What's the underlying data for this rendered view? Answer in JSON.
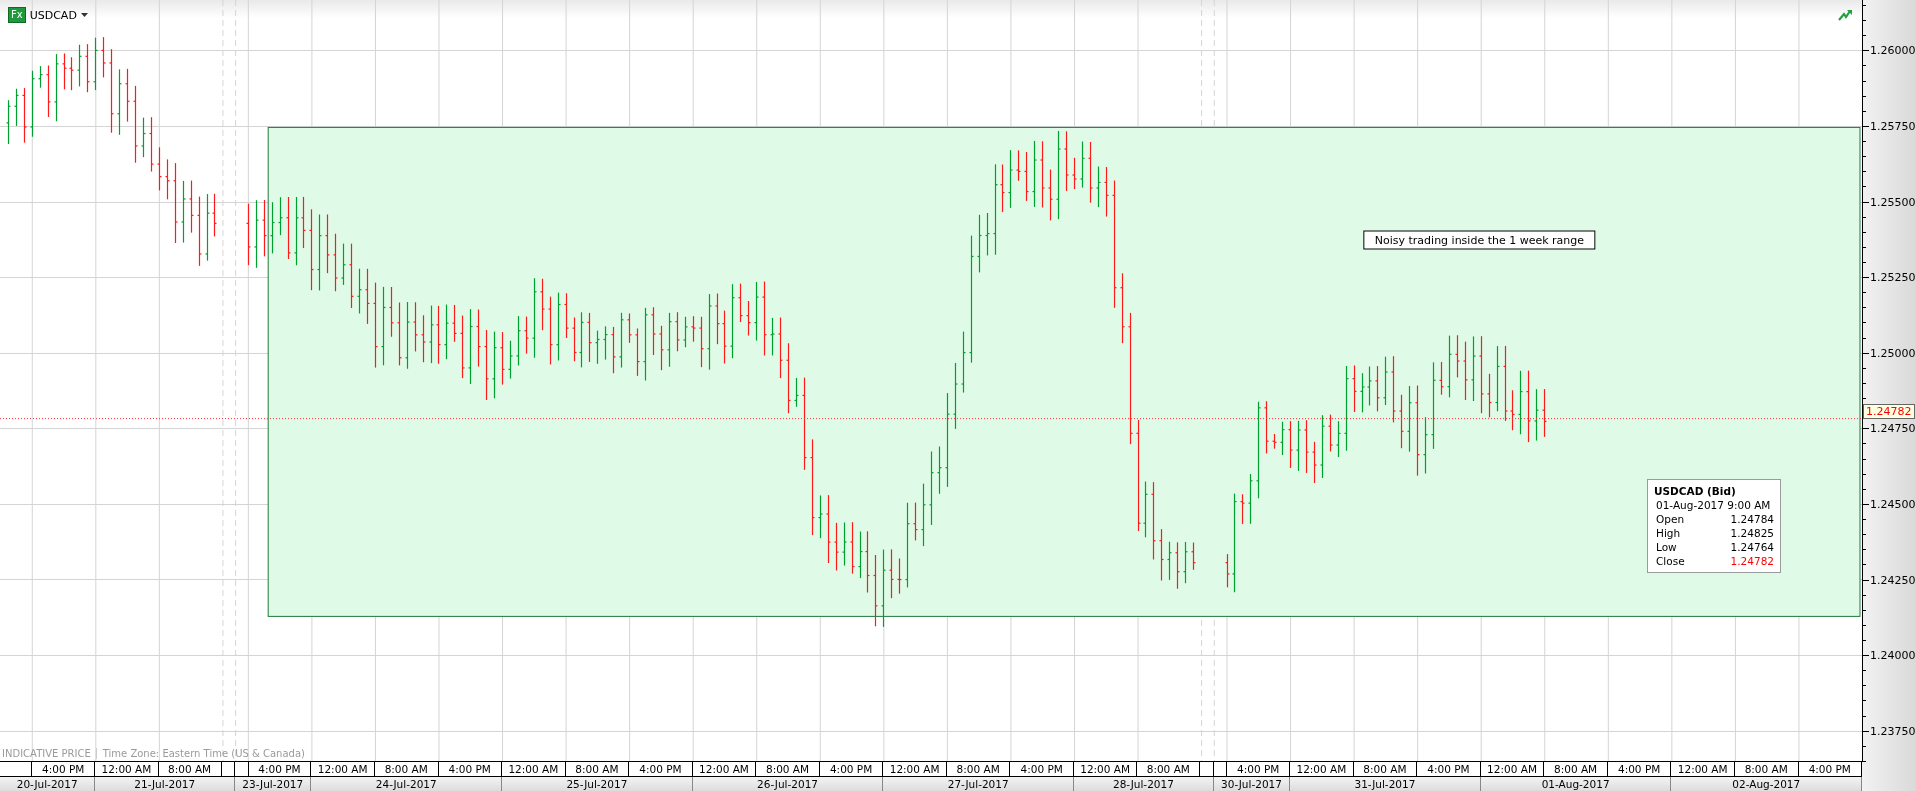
{
  "header": {
    "icon_text": "Fx",
    "symbol": "USDCAD"
  },
  "chart": {
    "price_axis": [
      "1.26000",
      "1.25750",
      "1.25500",
      "1.25250",
      "1.25000",
      "1.24750",
      "1.24500",
      "1.24250",
      "1.24000",
      "1.23750"
    ],
    "current_price": "1.24782",
    "note": "Noisy trading inside the 1 week range",
    "footnote": {
      "source": "INDICATIVE PRICE",
      "timezone": "Time Zone: Eastern Time (US & Canada)"
    },
    "tooltip": {
      "title": "USDCAD (Bid)",
      "time": "01-Aug-2017 9:00 AM",
      "rows": [
        {
          "label": "Open",
          "value": "1.24784",
          "highlight": false
        },
        {
          "label": "High",
          "value": "1.24825",
          "highlight": false
        },
        {
          "label": "Low",
          "value": "1.24764",
          "highlight": false
        },
        {
          "label": "Close",
          "value": "1.24782",
          "highlight": true
        }
      ]
    }
  },
  "time_axis": {
    "days": [
      {
        "date": "20-Jul-2017",
        "slots": [
          {
            "kind": "lead"
          },
          {
            "kind": "time",
            "label": "4:00 PM"
          }
        ]
      },
      {
        "date": "21-Jul-2017",
        "slots": [
          {
            "kind": "time",
            "label": "12:00 AM"
          },
          {
            "kind": "time",
            "label": "8:00 AM"
          },
          {
            "kind": "gap"
          }
        ]
      },
      {
        "date": "23-Jul-2017",
        "slots": [
          {
            "kind": "gap"
          },
          {
            "kind": "time",
            "label": "4:00 PM"
          }
        ]
      },
      {
        "date": "24-Jul-2017",
        "slots": [
          {
            "kind": "time",
            "label": "12:00 AM"
          },
          {
            "kind": "time",
            "label": "8:00 AM"
          },
          {
            "kind": "time",
            "label": "4:00 PM"
          }
        ]
      },
      {
        "date": "25-Jul-2017",
        "slots": [
          {
            "kind": "time",
            "label": "12:00 AM"
          },
          {
            "kind": "time",
            "label": "8:00 AM"
          },
          {
            "kind": "time",
            "label": "4:00 PM"
          }
        ]
      },
      {
        "date": "26-Jul-2017",
        "slots": [
          {
            "kind": "time",
            "label": "12:00 AM"
          },
          {
            "kind": "time",
            "label": "8:00 AM"
          },
          {
            "kind": "time",
            "label": "4:00 PM"
          }
        ]
      },
      {
        "date": "27-Jul-2017",
        "slots": [
          {
            "kind": "time",
            "label": "12:00 AM"
          },
          {
            "kind": "time",
            "label": "8:00 AM"
          },
          {
            "kind": "time",
            "label": "4:00 PM"
          }
        ]
      },
      {
        "date": "28-Jul-2017",
        "slots": [
          {
            "kind": "time",
            "label": "12:00 AM"
          },
          {
            "kind": "time",
            "label": "8:00 AM"
          },
          {
            "kind": "gap"
          }
        ]
      },
      {
        "date": "30-Jul-2017",
        "slots": [
          {
            "kind": "gap"
          },
          {
            "kind": "time",
            "label": "4:00 PM"
          }
        ]
      },
      {
        "date": "31-Jul-2017",
        "slots": [
          {
            "kind": "time",
            "label": "12:00 AM"
          },
          {
            "kind": "time",
            "label": "8:00 AM"
          },
          {
            "kind": "time",
            "label": "4:00 PM"
          }
        ]
      },
      {
        "date": "01-Aug-2017",
        "slots": [
          {
            "kind": "time",
            "label": "12:00 AM"
          },
          {
            "kind": "time",
            "label": "8:00 AM"
          },
          {
            "kind": "time",
            "label": "4:00 PM"
          }
        ]
      },
      {
        "date": "02-Aug-2017",
        "slots": [
          {
            "kind": "time",
            "label": "12:00 AM"
          },
          {
            "kind": "time",
            "label": "8:00 AM"
          },
          {
            "kind": "time",
            "label": "4:00 PM"
          }
        ]
      }
    ]
  }
}
